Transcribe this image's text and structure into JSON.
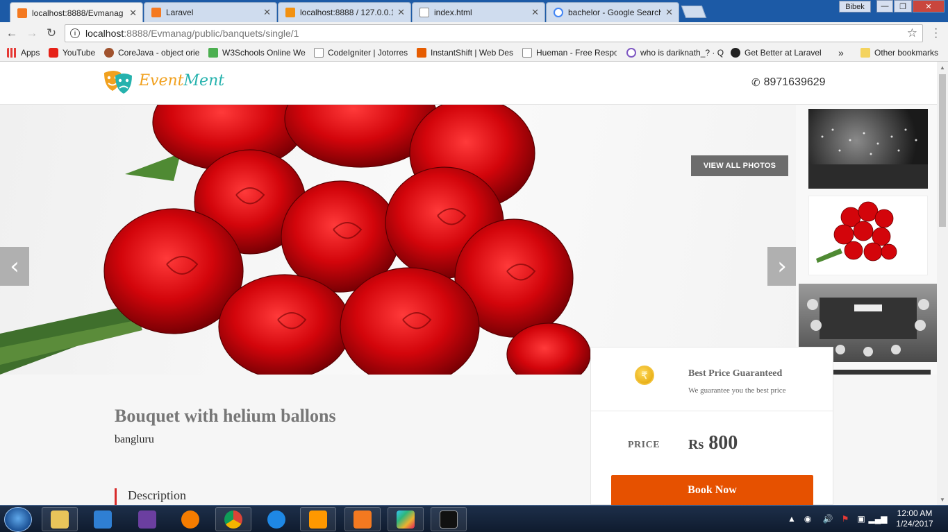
{
  "browser": {
    "tabs": [
      {
        "label": "localhost:8888/Evmanag",
        "icon": "xampp-icon",
        "color": "#f47920",
        "active": true
      },
      {
        "label": "Laravel",
        "icon": "xampp-icon",
        "color": "#f47920",
        "active": false
      },
      {
        "label": "localhost:8888 / 127.0.0.1",
        "icon": "phpmyadmin-icon",
        "color": "#f29111",
        "active": false
      },
      {
        "label": "index.html",
        "icon": "document-icon",
        "color": "#888888",
        "active": false
      },
      {
        "label": "bachelor - Google Search",
        "icon": "google-icon",
        "color": "#4285f4",
        "active": false
      }
    ],
    "user_badge": "Bibek",
    "url_host": "localhost",
    "url_path": ":8888/Evmanag/public/banquets/single/1",
    "bookmarks": [
      {
        "label": "Apps",
        "icon": "apps-icon",
        "color": "#e53935"
      },
      {
        "label": "YouTube",
        "icon": "youtube-icon",
        "color": "#e62117"
      },
      {
        "label": "CoreJava - object orie",
        "icon": "avatar-icon",
        "color": "#a0522d"
      },
      {
        "label": "W3Schools Online We",
        "icon": "w3schools-icon",
        "color": "#4caf50"
      },
      {
        "label": "CodeIgniter | Jotorres",
        "icon": "document-icon",
        "color": "#888888"
      },
      {
        "label": "InstantShift | Web Des",
        "icon": "cube-icon",
        "color": "#e65c00"
      },
      {
        "label": "Hueman - Free Respo",
        "icon": "document-icon",
        "color": "#888888"
      },
      {
        "label": "who is dariknath_? · Q",
        "icon": "quora-icon",
        "color": "#7e57c2"
      },
      {
        "label": "Get Better at Laravel",
        "icon": "laracasts-icon",
        "color": "#222222"
      }
    ],
    "overflow": "»",
    "other_bookmarks": "Other bookmarks"
  },
  "site": {
    "logo_part1": "Event",
    "logo_part2": "Ment",
    "phone": "8971639629",
    "view_all": "VIEW ALL PHOTOS",
    "prev": "‹",
    "next": "›"
  },
  "listing": {
    "title": "Bouquet with helium ballons",
    "location": "bangluru",
    "description_heading": "Description"
  },
  "pricing": {
    "badge_title": "Best Price Guaranteed",
    "badge_sub": "We guarantee you the best price",
    "coin_symbol": "₹",
    "price_label": "PRICE",
    "currency": "Rs",
    "amount": "800",
    "book_button": "Book Now"
  },
  "taskbar": {
    "time": "12:00 AM",
    "date": "1/24/2017",
    "items": [
      "explorer-icon",
      "media-player-icon",
      "visual-studio-icon",
      "uc-browser-icon",
      "chrome-icon",
      "internet-explorer-icon",
      "sublime-text-icon",
      "xampp-icon",
      "slack-icon",
      "cmd-icon"
    ]
  },
  "colors": {
    "accent": "#e65100",
    "logo_orange": "#f1a11f",
    "logo_teal": "#25b2ad",
    "desc_bar": "#d82b2b"
  }
}
